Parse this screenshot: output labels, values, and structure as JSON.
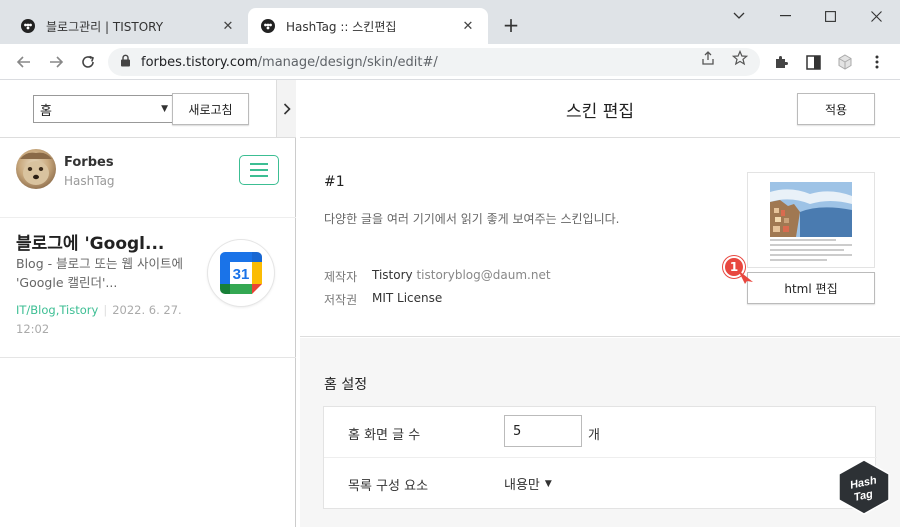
{
  "browser": {
    "tabs": [
      {
        "title": "블로그관리 | TISTORY",
        "active": false
      },
      {
        "title": "HashTag :: 스킨편집",
        "active": true
      }
    ],
    "url_host": "forbes.tistory.com",
    "url_path": "/manage/design/skin/edit#/"
  },
  "sidebar": {
    "page_select": "홈",
    "refresh_label": "새로고침",
    "profile": {
      "name": "Forbes",
      "blog": "HashTag"
    },
    "post": {
      "title": "블로그에 'Googl...",
      "summary": "Blog - 블로그 또는 웹 사이트에 'Google 캘린더'...",
      "category": "IT/Blog,Tistory",
      "date": "2022. 6. 27. 12:02",
      "thumb_number": "31"
    }
  },
  "main": {
    "title": "스킨 편집",
    "apply_label": "적용",
    "skin": {
      "name": "#1",
      "description": "다양한 글을 여러 기기에서 읽기 좋게 보여주는 스킨입니다.",
      "maker_label": "제작자",
      "maker": "Tistory",
      "maker_email": "tistoryblog@daum.net",
      "license_label": "저작권",
      "license": "MIT License",
      "html_edit_label": "html 편집",
      "marker_label": "1"
    },
    "home_settings": {
      "title": "홈 설정",
      "rows": [
        {
          "label": "홈 화면 글 수",
          "value": "5",
          "unit": "개"
        },
        {
          "label": "목록 구성 요소",
          "value": "내용만"
        }
      ]
    }
  },
  "watermark": {
    "text": "Hash Tag"
  },
  "colors": {
    "accent": "#3cbe93",
    "marker": "#e8473f"
  }
}
